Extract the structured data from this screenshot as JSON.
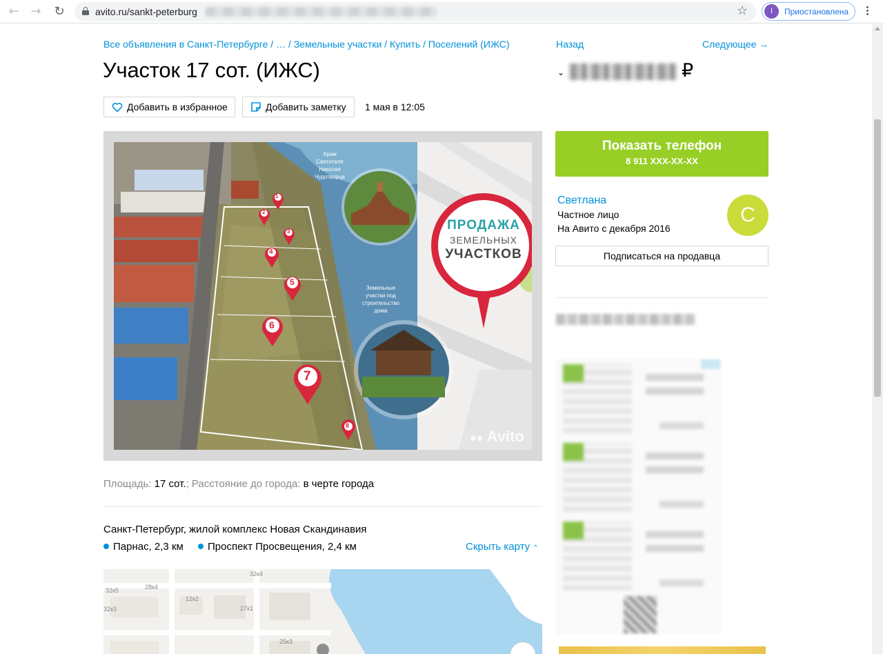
{
  "browser": {
    "url_visible": "avito.ru/sankt-peterburg",
    "profile_initial": "I",
    "profile_status": "Приостановлена"
  },
  "listing": {
    "breadcrumb": "Все объявления в Санкт-Петербурге / … / Земельные участки / Купить / Поселений (ИЖС)",
    "title": "Участок 17 сот. (ИЖС)",
    "favorite_label": "Добавить в избранное",
    "note_label": "Добавить заметку",
    "date": "1 мая в 12:05",
    "photo": {
      "caption_church": [
        "Храм",
        "Святителя",
        "Николая",
        "Чудотворца"
      ],
      "caption_plots": [
        "Земельные",
        "участки под",
        "строительство",
        "дома"
      ],
      "badge_lines": [
        "ПРОДАЖА",
        "ЗЕМЕЛЬНЫХ",
        "УЧАСТКОВ"
      ],
      "watermark": "Avito",
      "markers": [
        "1",
        "2",
        "3",
        "4",
        "5",
        "6",
        "7",
        "8"
      ]
    },
    "params": {
      "area_label": "Площадь:",
      "area_value": "17 сот.",
      "separator": ";",
      "distance_label": "Расстояние до города:",
      "distance_value": "в черте города"
    },
    "address": "Санкт-Петербург, жилой комплекс Новая Скандинавия",
    "metro": [
      {
        "name": "Парнас, 2,3 км"
      },
      {
        "name": "Проспект Просвещения, 2,4 км"
      }
    ],
    "hide_map_label": "Скрыть карту",
    "map_labels": [
      "32к4",
      "32к5",
      "28к4",
      "12к2",
      "27к1",
      "32к3",
      "25к3"
    ]
  },
  "sidebar": {
    "back_label": "Назад",
    "next_label": "Следующее →",
    "currency": "₽",
    "phone_button_title": "Показать телефон",
    "phone_masked": "8 911 XXX-XX-XX",
    "seller": {
      "name": "Светлана",
      "type": "Частное лицо",
      "since": "На Авито с декабря 2016",
      "avatar_letter": "С"
    },
    "subscribe_label": "Подписаться на продавца"
  },
  "colors": {
    "link": "#0091d9",
    "phone_button": "#97cf26",
    "avatar": "#c9dc3a",
    "badge_red": "#d8263d"
  }
}
